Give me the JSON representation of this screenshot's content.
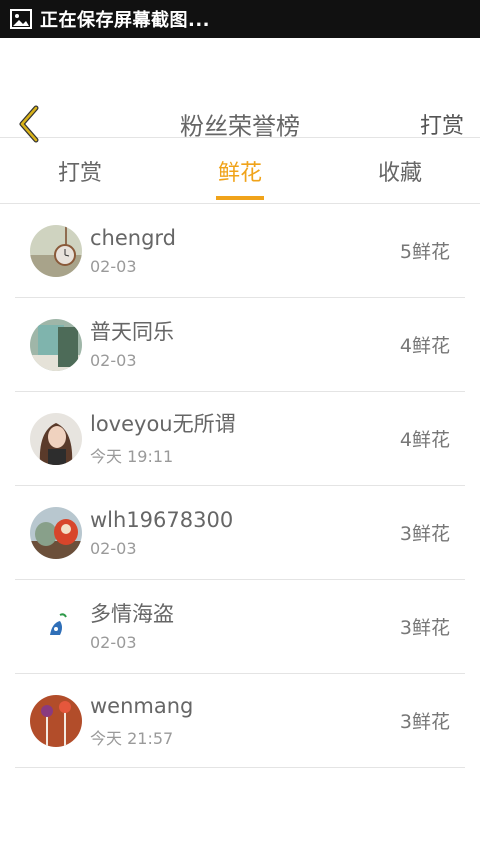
{
  "status": {
    "text": "正在保存屏幕截图..."
  },
  "header": {
    "title": "粉丝荣誉榜",
    "action": "打赏"
  },
  "tabs": [
    {
      "label": "打赏",
      "active": false
    },
    {
      "label": "鲜花",
      "active": true
    },
    {
      "label": "收藏",
      "active": false
    }
  ],
  "list": [
    {
      "name": "chengrd",
      "date": "02-03",
      "count": "5鲜花"
    },
    {
      "name": "普天同乐",
      "date": "02-03",
      "count": "4鲜花"
    },
    {
      "name": "loveyou无所谓",
      "date": "今天 19:11",
      "count": "4鲜花"
    },
    {
      "name": "wlh19678300",
      "date": "02-03",
      "count": "3鲜花"
    },
    {
      "name": "多情海盗",
      "date": "02-03",
      "count": "3鲜花"
    },
    {
      "name": "wenmang",
      "date": "今天 21:57",
      "count": "3鲜花"
    }
  ],
  "colors": {
    "accent": "#f0a31a",
    "back_icon": "#d8b21a"
  }
}
